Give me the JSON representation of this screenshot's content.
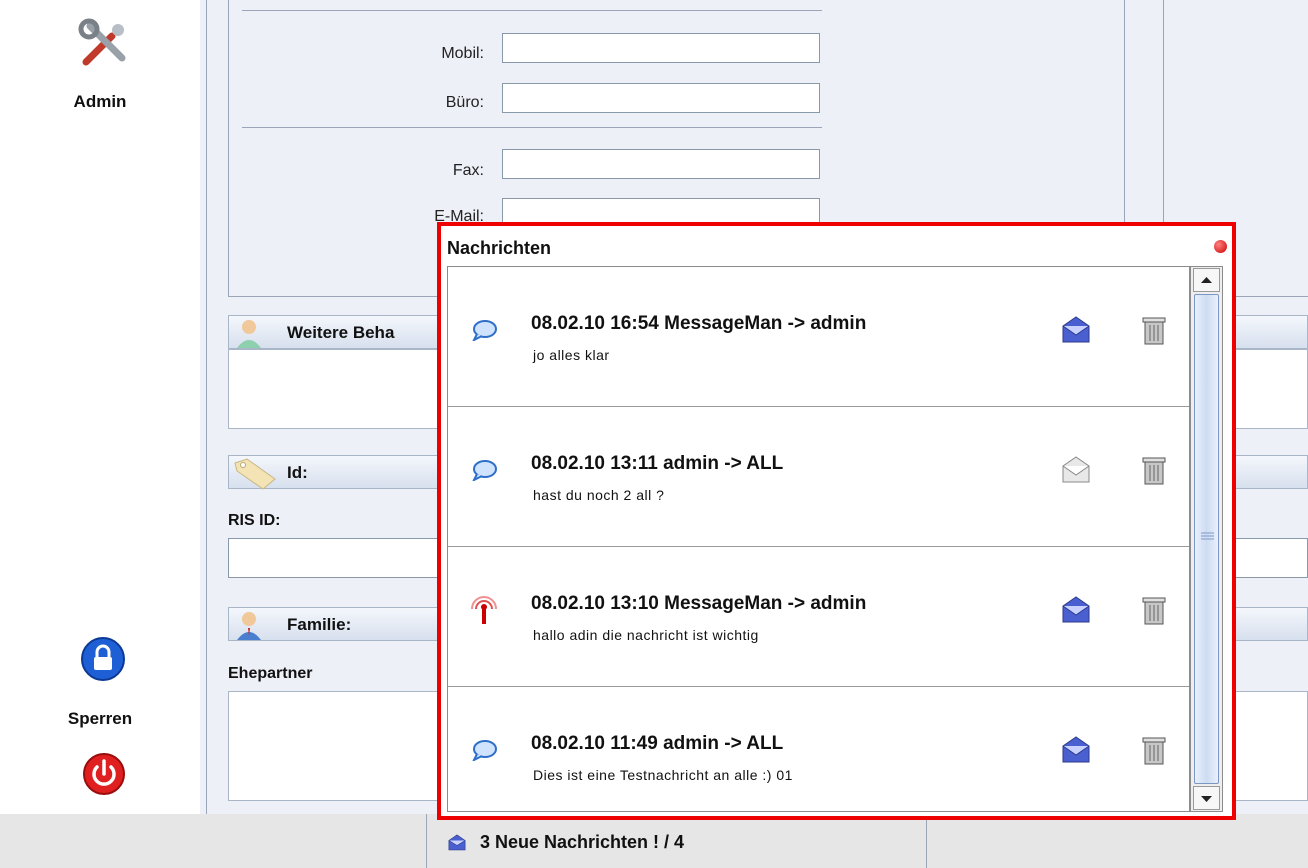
{
  "sidebar": {
    "admin_label": "Admin",
    "lock_label": "Sperren"
  },
  "form": {
    "mobil_label": "Mobil:",
    "buero_label": "Büro:",
    "fax_label": "Fax:",
    "email_label": "E-Mail:",
    "weitere_label": "Weitere Beha",
    "id_label": "Id:",
    "ris_label": "RIS ID:",
    "familie_label": "Familie:",
    "ehepartner_label": "Ehepartner"
  },
  "dialog": {
    "title": "Nachrichten",
    "messages": [
      {
        "title": "08.02.10 16:54 MessageMan -> admin",
        "body": "jo alles klar",
        "type": "normal",
        "read": false
      },
      {
        "title": "08.02.10 13:11 admin -> ALL",
        "body": "hast du noch 2 all ?",
        "type": "normal",
        "read": true
      },
      {
        "title": "08.02.10 13:10 MessageMan -> admin",
        "body": "hallo adin die nachricht ist wichtig",
        "type": "important",
        "read": false
      },
      {
        "title": "08.02.10 11:49 admin -> ALL",
        "body": "Dies ist eine Testnachricht an alle :) 01",
        "type": "normal",
        "read": false
      }
    ]
  },
  "footer": {
    "status": "3 Neue Nachrichten ! / 4"
  },
  "colors": {
    "dialog_border": "#ee0000",
    "unread_envelope": "#4a5fd0",
    "read_envelope": "#cccccc"
  }
}
